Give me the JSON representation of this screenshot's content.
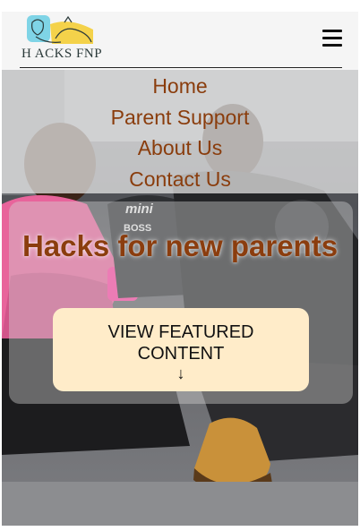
{
  "header": {
    "logo_text": "H ACKS FNP",
    "logo_icon": "family-logo-icon",
    "menu_icon": "hamburger-menu-icon"
  },
  "nav": {
    "items": [
      {
        "label": "Home"
      },
      {
        "label": "Parent Support"
      },
      {
        "label": "About Us"
      },
      {
        "label": "Contact Us"
      }
    ]
  },
  "hero": {
    "headline": "Hacks for new parents",
    "cta_label": "VIEW FEATURED CONTENT",
    "cta_arrow": "↓",
    "shirt_text_1": "mini",
    "shirt_text_2": "BOSS"
  },
  "colors": {
    "accent": "#8b3d0e",
    "button_bg": "#ffecc9",
    "header_bg": "#f5f5f5"
  }
}
